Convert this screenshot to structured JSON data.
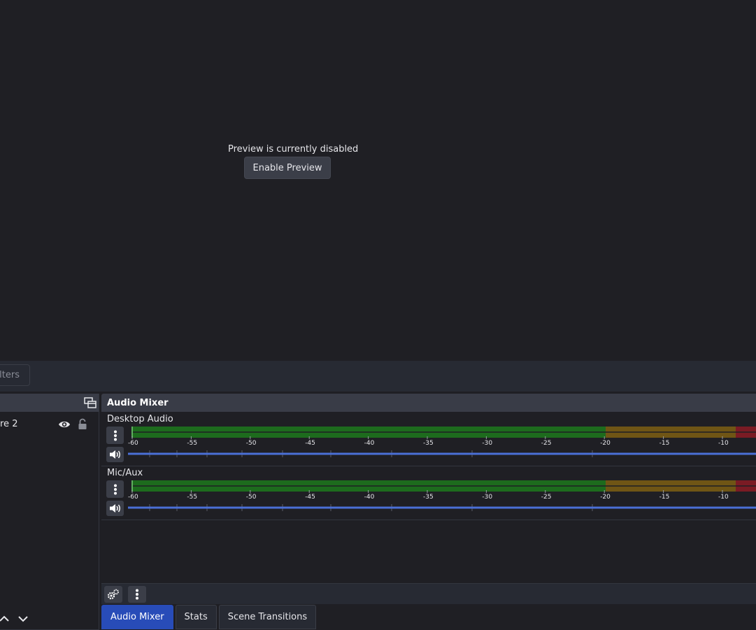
{
  "preview": {
    "message": "Preview is currently disabled",
    "enable_button": "Enable Preview"
  },
  "context_bar": {
    "filters_label": "ilters"
  },
  "sources": {
    "items": [
      {
        "label": "re 2",
        "visible": true,
        "locked": false
      }
    ]
  },
  "mixer": {
    "title": "Audio Mixer",
    "scale_ticks": [
      "-60",
      "-55",
      "-50",
      "-45",
      "-40",
      "-35",
      "-30",
      "-25",
      "-20",
      "-15",
      "-10"
    ],
    "channels": [
      {
        "name": "Desktop Audio",
        "level_db": -60,
        "volume": 1.0
      },
      {
        "name": "Mic/Aux",
        "level_db": -60,
        "volume": 1.0
      }
    ],
    "colors": {
      "green": "#1d6b1d",
      "yellow": "#6f5515",
      "red": "#7a1b24",
      "fader": "#4a6fd6"
    }
  },
  "tabs": [
    {
      "label": "Audio Mixer",
      "active": true
    },
    {
      "label": "Stats",
      "active": false
    },
    {
      "label": "Scene Transitions",
      "active": false
    }
  ]
}
